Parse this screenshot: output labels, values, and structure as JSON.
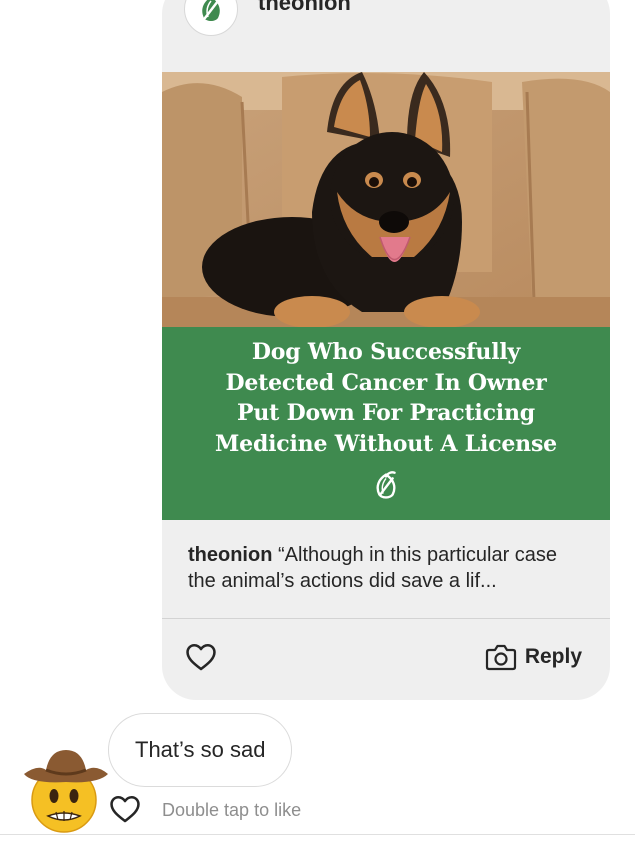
{
  "post": {
    "username": "theonion",
    "headline_lines": [
      "Dog Who Successfully",
      "Detected Cancer In Owner",
      "Put Down For Practicing",
      "Medicine Without A License"
    ],
    "caption_user": "theonion",
    "caption_text": "“Although in this particular case the animal’s actions did save a lif...",
    "reply_label": "Reply",
    "headline_bg": "#3f8a4f",
    "photo_icon": "camera-icon",
    "like_icon": "heart-outline-icon"
  },
  "message": {
    "text": "That’s so sad",
    "hint": "Double tap to like",
    "avatar_icon": "cowboy-face-emoji"
  }
}
